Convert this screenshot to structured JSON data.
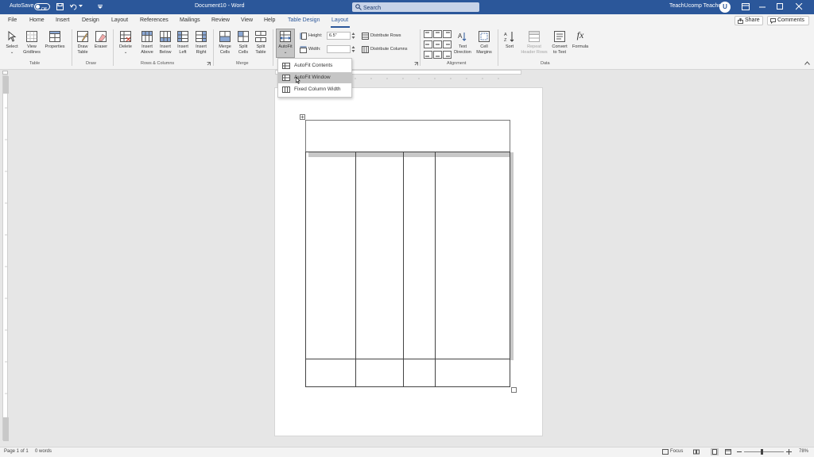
{
  "titlebar": {
    "autosave_label": "AutoSave",
    "autosave_state": "Off",
    "doc_title": "Document10  -  Word",
    "search_placeholder": "Search",
    "user_name": "TeachUcomp Teacher",
    "avatar_letter": "U"
  },
  "tabs": [
    "File",
    "Home",
    "Insert",
    "Design",
    "Layout",
    "References",
    "Mailings",
    "Review",
    "View",
    "Help",
    "Table Design",
    "Layout"
  ],
  "share_label": "Share",
  "comments_label": "Comments",
  "ribbon": {
    "table": {
      "select": "Select",
      "view_gridlines_1": "View",
      "view_gridlines_2": "Gridlines",
      "properties": "Properties",
      "group": "Table"
    },
    "draw": {
      "draw_table_1": "Draw",
      "draw_table_2": "Table",
      "eraser": "Eraser",
      "group": "Draw"
    },
    "rows_columns": {
      "delete": "Delete",
      "insert_above_1": "Insert",
      "insert_above_2": "Above",
      "insert_below_1": "Insert",
      "insert_below_2": "Below",
      "insert_left_1": "Insert",
      "insert_left_2": "Left",
      "insert_right_1": "Insert",
      "insert_right_2": "Right",
      "group": "Rows & Columns"
    },
    "merge": {
      "merge_cells_1": "Merge",
      "merge_cells_2": "Cells",
      "split_cells_1": "Split",
      "split_cells_2": "Cells",
      "split_table_1": "Split",
      "split_table_2": "Table",
      "group": "Merge"
    },
    "cell_size": {
      "autofit": "AutoFit",
      "height_label": "Height:",
      "height_value": "6.5\"",
      "width_label": "Width:",
      "width_value": "",
      "distribute_rows": "Distribute Rows",
      "distribute_columns": "Distribute Columns"
    },
    "alignment": {
      "text_direction_1": "Text",
      "text_direction_2": "Direction",
      "cell_margins_1": "Cell",
      "cell_margins_2": "Margins",
      "group": "Alignment"
    },
    "data": {
      "sort": "Sort",
      "repeat_header_1": "Repeat",
      "repeat_header_2": "Header Rows",
      "convert_1": "Convert",
      "convert_2": "to Text",
      "formula": "Formula",
      "fx": "fx",
      "group": "Data"
    }
  },
  "autofit_menu": [
    {
      "label": "AutoFit Contents"
    },
    {
      "label": "AutoFit Window"
    },
    {
      "label": "Fixed Column Width"
    }
  ],
  "statusbar": {
    "page": "Page 1 of 1",
    "words": "0 words",
    "focus": "Focus",
    "zoom": "78%"
  },
  "colors": {
    "accent": "#2b579a",
    "ribbon_bg": "#f3f3f3",
    "canvas_bg": "#e6e6e6"
  }
}
